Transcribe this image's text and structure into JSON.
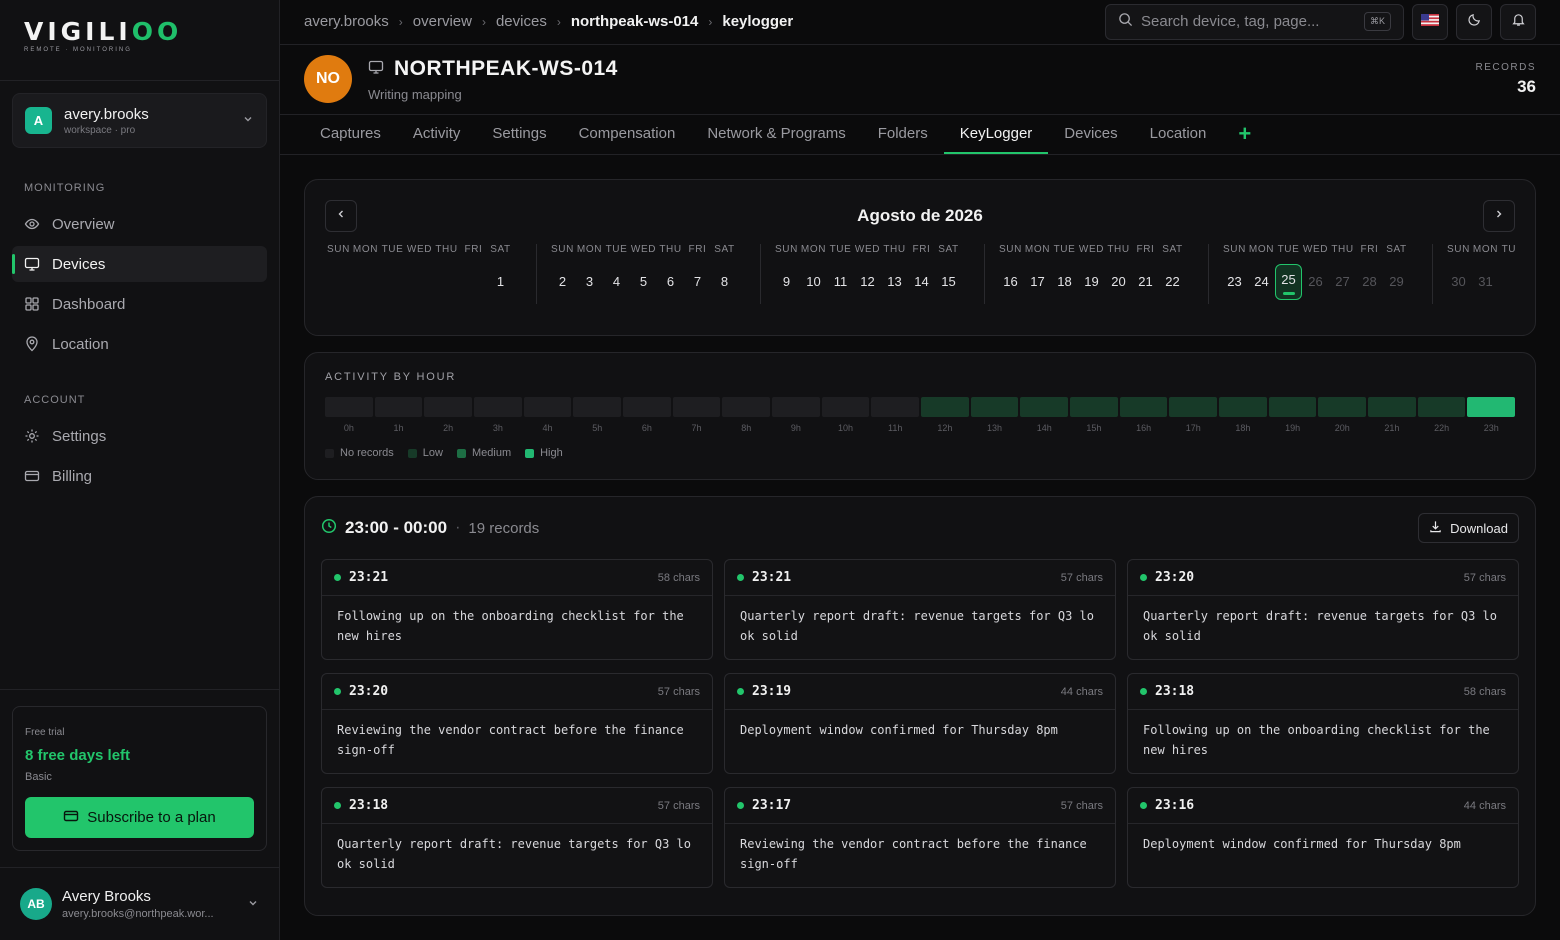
{
  "brand": {
    "name_main": "VIGILI",
    "name_accent": "OO",
    "tagline": "REMOTE · MONITORING"
  },
  "workspace": {
    "avatar": "A",
    "name": "avery.brooks",
    "plan": "workspace · pro"
  },
  "nav": {
    "monitoring_label": "MONITORING",
    "monitoring": [
      {
        "label": "Overview",
        "icon": "eye-icon"
      },
      {
        "label": "Devices",
        "icon": "monitor-icon",
        "active": true
      },
      {
        "label": "Dashboard",
        "icon": "grid-icon"
      },
      {
        "label": "Location",
        "icon": "pin-icon"
      }
    ],
    "account_label": "ACCOUNT",
    "account": [
      {
        "label": "Settings",
        "icon": "gear-icon"
      },
      {
        "label": "Billing",
        "icon": "card-icon"
      }
    ]
  },
  "trial": {
    "label": "Free trial",
    "days": "8 free days left",
    "plan": "Basic",
    "button": "Subscribe to a plan"
  },
  "user": {
    "initials": "AB",
    "name": "Avery Brooks",
    "email": "avery.brooks@northpeak.wor..."
  },
  "breadcrumb": [
    "avery.brooks",
    "overview",
    "devices",
    "northpeak-ws-014",
    "keylogger"
  ],
  "search": {
    "placeholder": "Search device, tag, page...",
    "shortcut": "⌘K"
  },
  "device": {
    "initials": "NO",
    "name": "NORTHPEAK-WS-014",
    "subtitle": "Writing mapping",
    "records_label": "RECORDS",
    "records": "36"
  },
  "tabs": [
    "Captures",
    "Activity",
    "Settings",
    "Compensation",
    "Network & Programs",
    "Folders",
    "KeyLogger",
    "Devices",
    "Location"
  ],
  "active_tab": "KeyLogger",
  "calendar": {
    "title": "Agosto de 2026",
    "weekdays": [
      "SUN",
      "MON",
      "TUE",
      "WED",
      "THU",
      "FRI",
      "SAT"
    ],
    "weeks": [
      [
        "",
        "",
        "",
        "",
        "",
        "",
        "1"
      ],
      [
        "2",
        "3",
        "4",
        "5",
        "6",
        "7",
        "8"
      ],
      [
        "9",
        "10",
        "11",
        "12",
        "13",
        "14",
        "15"
      ],
      [
        "16",
        "17",
        "18",
        "19",
        "20",
        "21",
        "22"
      ],
      [
        "23",
        "24",
        "25",
        "26",
        "27",
        "28",
        "29"
      ],
      [
        "30",
        "31",
        "",
        "",
        "",
        "",
        ""
      ]
    ],
    "selected": "25",
    "last_active": "25"
  },
  "activity": {
    "title": "ACTIVITY BY HOUR",
    "hours": [
      "0h",
      "1h",
      "2h",
      "3h",
      "4h",
      "5h",
      "6h",
      "7h",
      "8h",
      "9h",
      "10h",
      "11h",
      "12h",
      "13h",
      "14h",
      "15h",
      "16h",
      "17h",
      "18h",
      "19h",
      "20h",
      "21h",
      "22h",
      "23h"
    ],
    "levels": [
      0,
      0,
      0,
      0,
      0,
      0,
      0,
      0,
      0,
      0,
      0,
      0,
      1,
      1,
      1,
      1,
      1,
      1,
      1,
      1,
      1,
      1,
      1,
      3
    ],
    "legend": [
      "No records",
      "Low",
      "Medium",
      "High"
    ],
    "colors": {
      "none": "#1e1e21",
      "low": "#173a28",
      "medium": "#1d6e44",
      "high": "#22b872"
    }
  },
  "records": {
    "range": "23:00 - 00:00",
    "count": "19 records",
    "download": "Download",
    "entries": [
      {
        "time": "23:21",
        "chars": "58 chars",
        "text": "Following up on the onboarding checklist for the new hires"
      },
      {
        "time": "23:21",
        "chars": "57 chars",
        "text": "Quarterly report draft: revenue targets for Q3 look solid"
      },
      {
        "time": "23:20",
        "chars": "57 chars",
        "text": "Quarterly report draft: revenue targets for Q3 look solid"
      },
      {
        "time": "23:20",
        "chars": "57 chars",
        "text": "Reviewing the vendor contract before the finance sign-off"
      },
      {
        "time": "23:19",
        "chars": "44 chars",
        "text": "Deployment window confirmed for Thursday 8pm"
      },
      {
        "time": "23:18",
        "chars": "58 chars",
        "text": "Following up on the onboarding checklist for the new hires"
      },
      {
        "time": "23:18",
        "chars": "57 chars",
        "text": "Quarterly report draft: revenue targets for Q3 look solid"
      },
      {
        "time": "23:17",
        "chars": "57 chars",
        "text": "Reviewing the vendor contract before the finance sign-off"
      },
      {
        "time": "23:16",
        "chars": "44 chars",
        "text": "Deployment window confirmed for Thursday 8pm"
      }
    ]
  },
  "colors": {
    "accent": "#22c56b",
    "device_avatar": "#e07b0f",
    "workspace_avatar": "#18b58f"
  }
}
